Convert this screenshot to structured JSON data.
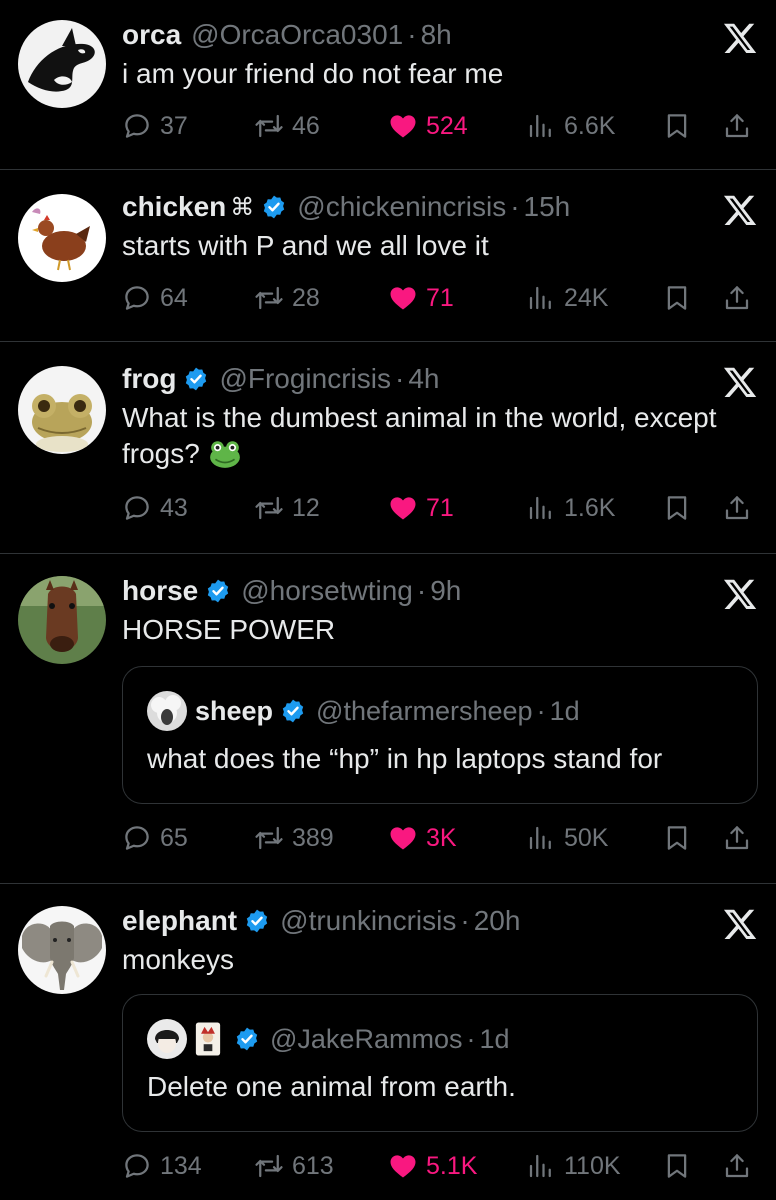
{
  "tweets": [
    {
      "name": "orca",
      "extra": "",
      "handle": "@OrcaOrca0301",
      "time": "8h",
      "text": "i am your friend do not fear me",
      "verified": false,
      "replies": "37",
      "retweets": "46",
      "likes": "524",
      "views": "6.6K"
    },
    {
      "name": "chicken",
      "extra": "⌘",
      "handle": "@chickenincrisis",
      "time": "15h",
      "text": "starts with P and we all love it",
      "verified": true,
      "replies": "64",
      "retweets": "28",
      "likes": "71",
      "views": "24K"
    },
    {
      "name": "frog",
      "extra": "",
      "handle": "@Frogincrisis",
      "time": "4h",
      "text_line1": "What is the dumbest animal in the world, except",
      "text_line2": "frogs?",
      "verified": true,
      "replies": "43",
      "retweets": "12",
      "likes": "71",
      "views": "1.6K"
    },
    {
      "name": "horse",
      "extra": "",
      "handle": "@horsetwting",
      "time": "9h",
      "text": "HORSE POWER",
      "verified": true,
      "quote": {
        "name": "sheep",
        "handle": "@thefarmersheep",
        "time": "1d",
        "text": "what does the “hp” in hp laptops stand for"
      },
      "replies": "65",
      "retweets": "389",
      "likes": "3K",
      "views": "50K"
    },
    {
      "name": "elephant",
      "extra": "",
      "handle": "@trunkincrisis",
      "time": "20h",
      "text": "monkeys",
      "verified": true,
      "quote": {
        "name": "",
        "handle": "@JakeRammos",
        "time": "1d",
        "text": "Delete one animal from earth."
      },
      "replies": "134",
      "retweets": "613",
      "likes": "5.1K",
      "views": "110K"
    }
  ],
  "colors": {
    "background": "#000000",
    "text": "#e7e9ea",
    "muted": "#71767b",
    "like": "#f91880",
    "verified": "#1d9bf0",
    "divider": "#2f3336"
  }
}
